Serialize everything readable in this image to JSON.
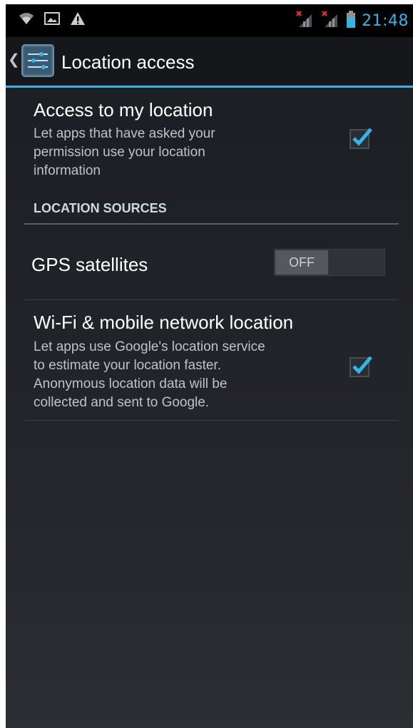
{
  "status_bar": {
    "left_icons": [
      "wifi-signal-icon",
      "image-notification-icon",
      "warning-icon"
    ],
    "right_icons": [
      "sim1-signal-no-service-icon",
      "sim2-signal-no-service-icon",
      "battery-icon"
    ],
    "time": "21:48",
    "accent_color": "#33b5e5"
  },
  "action_bar": {
    "title": "Location access",
    "up_icon": "chevron-left-icon",
    "app_icon": "settings-sliders-icon"
  },
  "preferences": {
    "access_location": {
      "title": "Access to my location",
      "summary": "Let apps that have asked your\npermission use your location\ninformation",
      "checked": true
    },
    "section_header": "LOCATION SOURCES",
    "gps": {
      "title": "GPS satellites",
      "toggle_label": "OFF",
      "on": false
    },
    "wifi_location": {
      "title": "Wi-Fi & mobile network location",
      "summary": "Let apps use Google's location service\nto estimate your location faster.\nAnonymous location data will be\ncollected and sent to Google.",
      "checked": true
    }
  },
  "colors": {
    "accent": "#33b5e5",
    "background": "#1e2126"
  }
}
